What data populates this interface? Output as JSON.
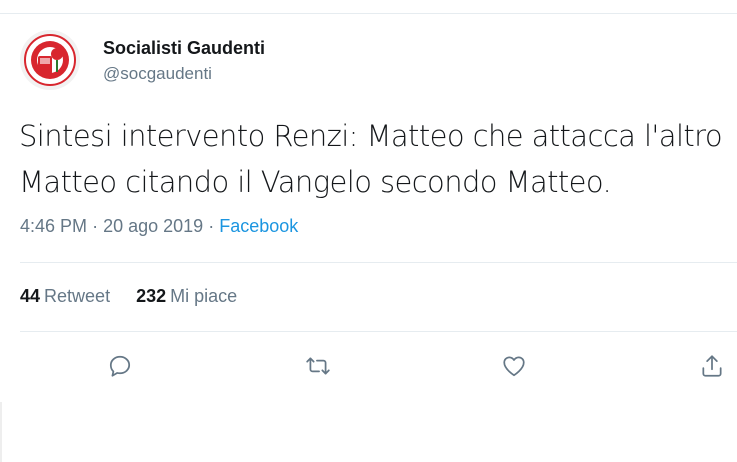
{
  "user": {
    "display_name": "Socialisti Gaudenti",
    "handle": "@socgaudenti",
    "avatar_icon": "socialist-rose-logo"
  },
  "tweet": {
    "text": "Sintesi intervento Renzi: Matteo che attacca l'altro Matteo citando il Vangelo secondo Matteo.",
    "time": "4:46 PM",
    "separator": "·",
    "date": "20 ago 2019",
    "source": "Facebook"
  },
  "stats": {
    "retweets_count": "44",
    "retweets_label": "Retweet",
    "likes_count": "232",
    "likes_label": "Mi piace"
  },
  "actions": [
    {
      "icon": "reply-icon"
    },
    {
      "icon": "retweet-icon"
    },
    {
      "icon": "like-icon"
    },
    {
      "icon": "share-icon"
    }
  ],
  "colors": {
    "text": "#14171a",
    "secondary": "#657786",
    "link": "#1b95e0",
    "border": "#e6ecf0"
  }
}
